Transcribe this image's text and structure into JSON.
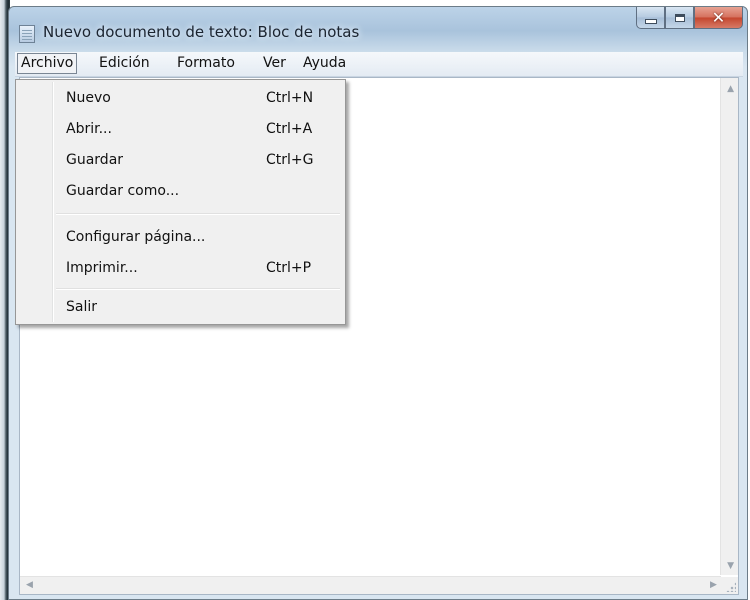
{
  "window": {
    "title": "Nuevo documento de texto: Bloc de notas",
    "icon": "notepad-icon"
  },
  "caption_buttons": {
    "minimize": "minimize-icon",
    "maximize": "maximize-icon",
    "close": "close-icon"
  },
  "menubar": {
    "items": [
      {
        "label": "Archivo",
        "active": true
      },
      {
        "label": "Edición",
        "active": false
      },
      {
        "label": "Formato",
        "active": false
      },
      {
        "label": "Ver",
        "active": false
      },
      {
        "label": "Ayuda",
        "active": false
      }
    ]
  },
  "archivo_menu": {
    "items": [
      {
        "label": "Nuevo",
        "shortcut": "Ctrl+N"
      },
      {
        "label": "Abrir...",
        "shortcut": "Ctrl+A"
      },
      {
        "label": "Guardar",
        "shortcut": "Ctrl+G"
      },
      {
        "label": "Guardar como...",
        "shortcut": ""
      },
      {
        "label": "Configurar página...",
        "shortcut": ""
      },
      {
        "label": "Imprimir...",
        "shortcut": "Ctrl+P"
      },
      {
        "label": "Salir",
        "shortcut": ""
      }
    ]
  },
  "editor": {
    "text": ""
  },
  "colors": {
    "titlebar": "#a9c3dc",
    "close_button": "#c4452d",
    "menu_bg": "#f0f0f0"
  }
}
